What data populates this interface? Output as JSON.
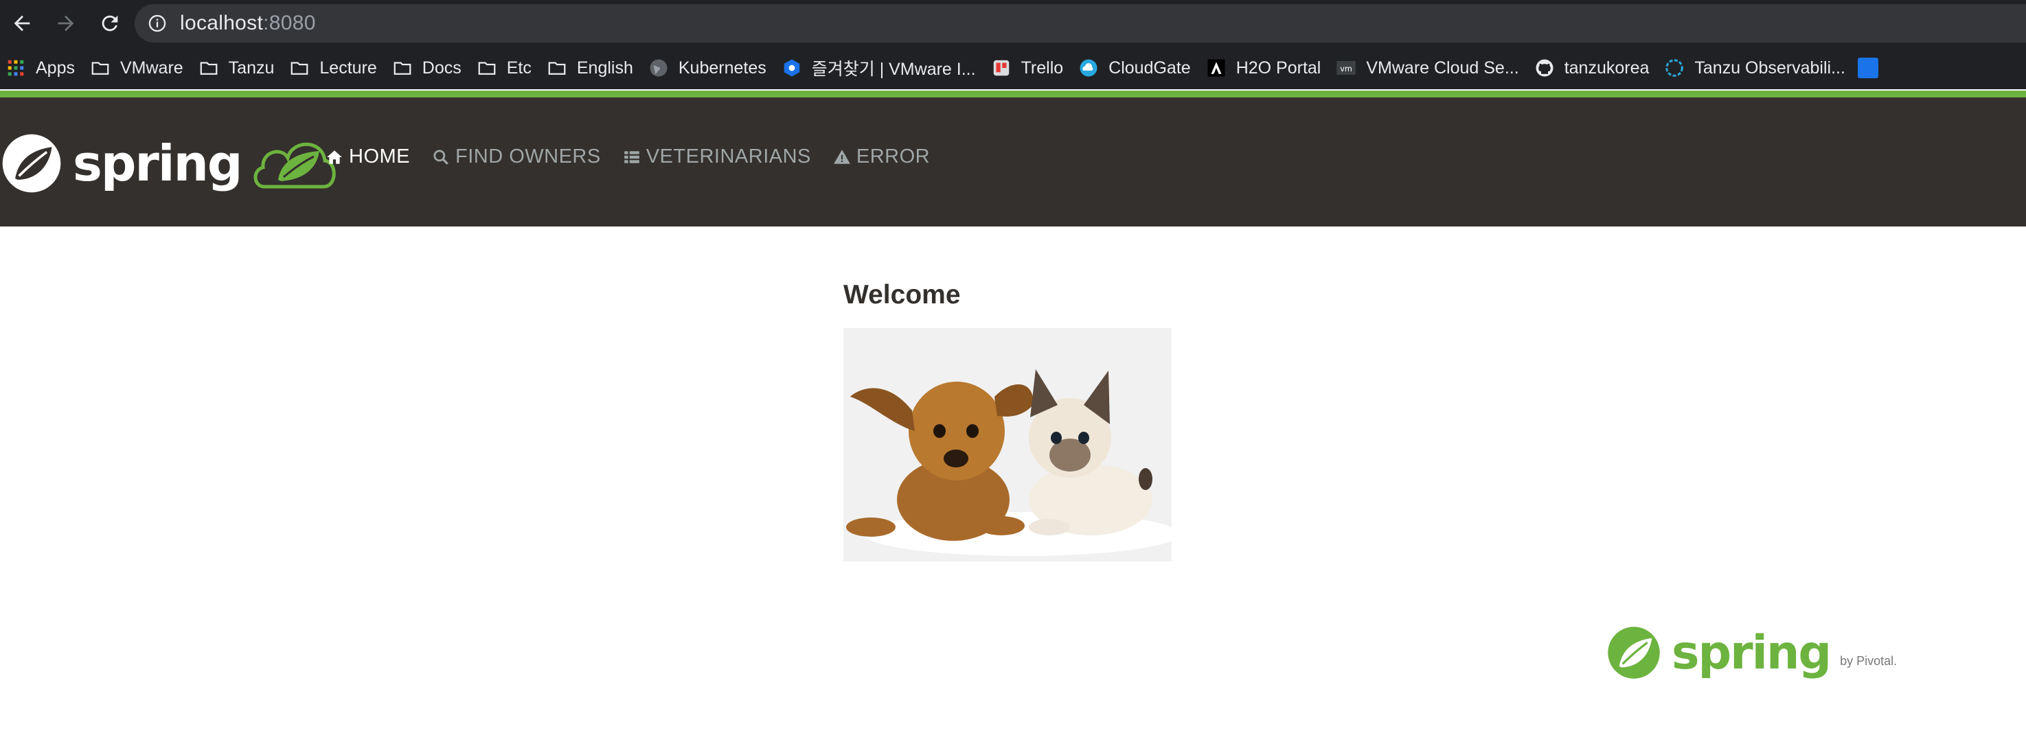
{
  "browser": {
    "url_host": "localhost",
    "url_port": ":8080",
    "bookmarks": [
      {
        "label": "Apps",
        "icon": "apps-grid-icon"
      },
      {
        "label": "VMware",
        "icon": "folder-icon"
      },
      {
        "label": "Tanzu",
        "icon": "folder-icon"
      },
      {
        "label": "Lecture",
        "icon": "folder-icon"
      },
      {
        "label": "Docs",
        "icon": "folder-icon"
      },
      {
        "label": "Etc",
        "icon": "folder-icon"
      },
      {
        "label": "English",
        "icon": "folder-icon"
      },
      {
        "label": "Kubernetes",
        "icon": "globe-icon"
      },
      {
        "label": "즐겨찾기 | VMware I...",
        "icon": "vmware-hex-icon"
      },
      {
        "label": "Trello",
        "icon": "trello-icon"
      },
      {
        "label": "CloudGate",
        "icon": "cloudgate-icon"
      },
      {
        "label": "H2O Portal",
        "icon": "h2o-icon"
      },
      {
        "label": "VMware Cloud Se...",
        "icon": "vm-icon"
      },
      {
        "label": "tanzukorea",
        "icon": "github-icon"
      },
      {
        "label": "Tanzu Observabili...",
        "icon": "tanzu-observability-icon"
      }
    ]
  },
  "app": {
    "brand": "spring",
    "nav": [
      {
        "label": "HOME",
        "icon": "home-icon",
        "active": true
      },
      {
        "label": "FIND OWNERS",
        "icon": "search-icon",
        "active": false
      },
      {
        "label": "VETERINARIANS",
        "icon": "list-icon",
        "active": false
      },
      {
        "label": "ERROR",
        "icon": "warning-icon",
        "active": false
      }
    ],
    "heading": "Welcome",
    "footer_brand": "spring",
    "footer_by": "by Pivotal."
  },
  "colors": {
    "spring_green": "#6db33f",
    "navbar_bg": "#34302d",
    "browser_bg": "#202124"
  }
}
